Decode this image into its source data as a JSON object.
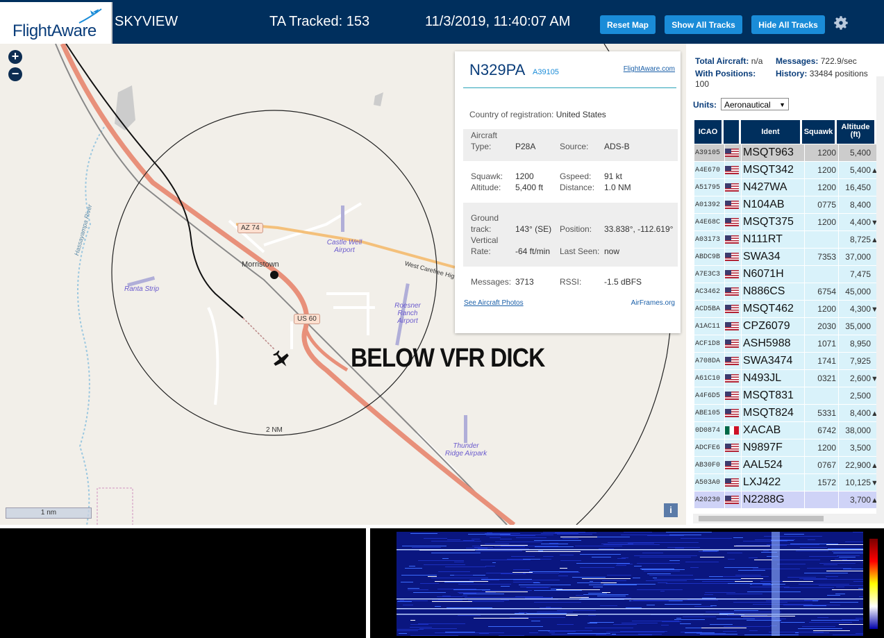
{
  "header": {
    "logo_text": "FlightAware",
    "app_title": "SKYVIEW",
    "tracked_label": "TA Tracked: 153",
    "datetime": "11/3/2019, 11:40:07 AM",
    "buttons": {
      "reset": "Reset Map",
      "show_all": "Show All Tracks",
      "hide_all": "Hide All Tracks"
    }
  },
  "map": {
    "zoom_in": "+",
    "zoom_out": "−",
    "labels": {
      "town": "Morristown",
      "river": "Hassayampa River",
      "road_az74": "AZ 74",
      "road_us60": "US 60",
      "road_carefree": "West Carefree Hig",
      "ring": "2 NM",
      "scale": "1 nm"
    },
    "airports": {
      "castle": "Castle Well Airport",
      "ranta": "Ranta Strip",
      "roesner": "Roesner Ranch Airport",
      "thunder": "Thunder Ridge Airpark"
    },
    "overlay_text": "BELOW VFR DICK",
    "info_label": "i"
  },
  "popup": {
    "registration": "N329PA",
    "icao": "A39105",
    "link": "FlightAware.com",
    "country_label": "Country of registration:",
    "country_value": "United States",
    "aircraft_type_label": "Aircraft Type:",
    "aircraft_type_value": "P28A",
    "source_label": "Source:",
    "source_value": "ADS-B",
    "squawk_label": "Squawk:",
    "squawk_value": "1200",
    "gspeed_label": "Gspeed:",
    "gspeed_value": "91 kt",
    "altitude_label": "Altitude:",
    "altitude_value": "5,400 ft",
    "distance_label": "Distance:",
    "distance_value": "1.0 NM",
    "track_label": "Ground track:",
    "track_value": "143° (SE)",
    "position_label": "Position:",
    "position_value": "33.838°, -112.619°",
    "vrate_label": "Vertical Rate:",
    "vrate_value": "-64 ft/min",
    "lastseen_label": "Last Seen:",
    "lastseen_value": "now",
    "messages_label": "Messages:",
    "messages_value": "3713",
    "rssi_label": "RSSI:",
    "rssi_value": "-1.5 dBFS",
    "photos_link": "See Aircraft Photos",
    "airframes_link": "AirFrames.org"
  },
  "sidebar": {
    "total_label": "Total Aircraft:",
    "total_value": "n/a",
    "messages_label": "Messages:",
    "messages_value": "722.9/sec",
    "positions_label": "With Positions:",
    "positions_value": "100",
    "history_label": "History:",
    "history_value": "33484 positions",
    "units_label": "Units:",
    "units_value": "Aeronautical",
    "columns": {
      "icao": "ICAO",
      "ident": "Ident",
      "squawk": "Squawk",
      "altitude": "Altitude (ft)"
    },
    "rows": [
      {
        "icao": "A39105",
        "flag": "us",
        "ident": "MSQT963",
        "squawk": "1200",
        "alt": "5,400",
        "trend": ""
      },
      {
        "icao": "A4E670",
        "flag": "us",
        "ident": "MSQT342",
        "squawk": "1200",
        "alt": "5,400",
        "trend": "▲"
      },
      {
        "icao": "A51795",
        "flag": "us",
        "ident": "N427WA",
        "squawk": "1200",
        "alt": "16,450",
        "trend": ""
      },
      {
        "icao": "A01392",
        "flag": "us",
        "ident": "N104AB",
        "squawk": "0775",
        "alt": "8,400",
        "trend": ""
      },
      {
        "icao": "A4E68C",
        "flag": "us",
        "ident": "MSQT375",
        "squawk": "1200",
        "alt": "4,400",
        "trend": "▼"
      },
      {
        "icao": "A03173",
        "flag": "us",
        "ident": "N111RT",
        "squawk": "",
        "alt": "8,725",
        "trend": "▲"
      },
      {
        "icao": "ABDC9B",
        "flag": "us",
        "ident": "SWA34",
        "squawk": "7353",
        "alt": "37,000",
        "trend": ""
      },
      {
        "icao": "A7E3C3",
        "flag": "us",
        "ident": "N6071H",
        "squawk": "",
        "alt": "7,475",
        "trend": ""
      },
      {
        "icao": "AC3462",
        "flag": "us",
        "ident": "N886CS",
        "squawk": "6754",
        "alt": "45,000",
        "trend": ""
      },
      {
        "icao": "ACD5BA",
        "flag": "us",
        "ident": "MSQT462",
        "squawk": "1200",
        "alt": "4,300",
        "trend": "▼"
      },
      {
        "icao": "A1AC11",
        "flag": "us",
        "ident": "CPZ6079",
        "squawk": "2030",
        "alt": "35,000",
        "trend": ""
      },
      {
        "icao": "ACF1D8",
        "flag": "us",
        "ident": "ASH5988",
        "squawk": "1071",
        "alt": "8,950",
        "trend": ""
      },
      {
        "icao": "A708DA",
        "flag": "us",
        "ident": "SWA3474",
        "squawk": "1741",
        "alt": "7,925",
        "trend": ""
      },
      {
        "icao": "A61C10",
        "flag": "us",
        "ident": "N493JL",
        "squawk": "0321",
        "alt": "2,600",
        "trend": "▼"
      },
      {
        "icao": "A4F6D5",
        "flag": "us",
        "ident": "MSQT831",
        "squawk": "",
        "alt": "2,500",
        "trend": ""
      },
      {
        "icao": "ABE105",
        "flag": "us",
        "ident": "MSQT824",
        "squawk": "5331",
        "alt": "8,400",
        "trend": "▲"
      },
      {
        "icao": "0D0874",
        "flag": "mx",
        "ident": "XACAB",
        "squawk": "6742",
        "alt": "38,000",
        "trend": ""
      },
      {
        "icao": "ADCFE6",
        "flag": "us",
        "ident": "N9897F",
        "squawk": "1200",
        "alt": "3,500",
        "trend": ""
      },
      {
        "icao": "AB30F0",
        "flag": "us",
        "ident": "AAL524",
        "squawk": "0767",
        "alt": "22,900",
        "trend": "▲"
      },
      {
        "icao": "A503A0",
        "flag": "us",
        "ident": "LXJ422",
        "squawk": "1572",
        "alt": "10,125",
        "trend": "▼"
      },
      {
        "icao": "A20230",
        "flag": "us",
        "ident": "N2288G",
        "squawk": "",
        "alt": "3,700",
        "trend": "▲"
      }
    ]
  },
  "colors": {
    "header_bg": "#002f5d",
    "button_bg": "#1a8cd8",
    "row_bg": "#d9f2fa",
    "row_selected": "#cccccc",
    "row_highlight": "#cfd3f7"
  }
}
